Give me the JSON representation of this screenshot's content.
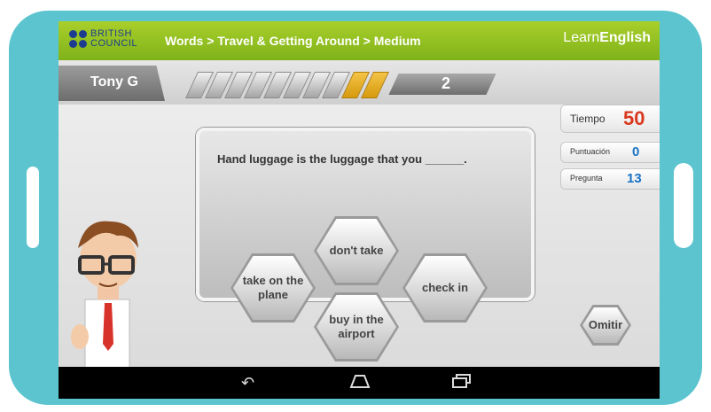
{
  "header": {
    "logo_line1": "BRITISH",
    "logo_line2": "COUNCIL",
    "breadcrumb": "Words > Travel & Getting Around > Medium",
    "brand_light": "Learn",
    "brand_bold": "English"
  },
  "player": {
    "name": "Tony G"
  },
  "progress": {
    "segments_total": 10,
    "segments_highlighted": [
      8,
      9
    ],
    "question_counter": "2"
  },
  "stats": [
    {
      "label": "Tiempo",
      "value": "50",
      "color": "#d9381e"
    },
    {
      "label": "Puntuación",
      "value": "0",
      "color": "#1a73c4"
    },
    {
      "label": "Pregunta",
      "value": "13",
      "color": "#1a73c4"
    }
  ],
  "question": {
    "text": "Hand luggage is the luggage that you ______."
  },
  "answers": [
    {
      "label": "don't take"
    },
    {
      "label": "take on the plane"
    },
    {
      "label": "check in"
    },
    {
      "label": "buy in the airport"
    }
  ],
  "skip_label": "Omitir",
  "colors": {
    "frame": "#5bc4cf",
    "topbar": "#8cbe1f",
    "accent": "#e0a81e"
  },
  "icons": [
    "back-icon",
    "home-icon",
    "recent-apps-icon"
  ]
}
